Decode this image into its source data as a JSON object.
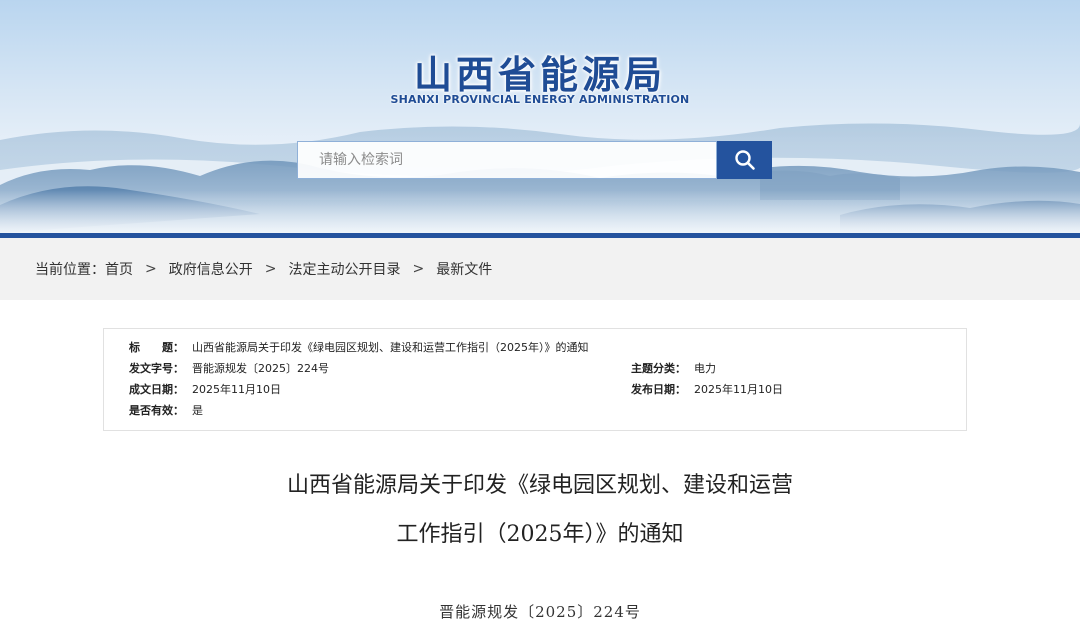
{
  "header": {
    "title_cn": "山西省能源局",
    "title_en": "SHANXI PROVINCIAL ENERGY ADMINISTRATION",
    "search_placeholder": "请输入检索词",
    "search_icon": "search-icon"
  },
  "breadcrumb": {
    "prefix": "当前位置：",
    "items": [
      "首页",
      "政府信息公开",
      "法定主动公开目录",
      "最新文件"
    ],
    "separator": ">"
  },
  "info": {
    "title_label": "标　　题：",
    "title_value": "山西省能源局关于印发《绿电园区规划、建设和运营工作指引（2025年）》的通知",
    "doc_no_label": "发文字号：",
    "doc_no_value": "晋能源规发〔2025〕224号",
    "category_label": "主题分类：",
    "category_value": "电力",
    "created_label": "成文日期：",
    "created_value": "2025年11月10日",
    "published_label": "发布日期：",
    "published_value": "2025年11月10日",
    "valid_label": "是否有效：",
    "valid_value": "是"
  },
  "article": {
    "title_line1": "山西省能源局关于印发《绿电园区规划、建设和运营",
    "title_line2": "工作指引（2025年）》的通知",
    "doc_number": "晋能源规发〔2025〕224号"
  },
  "colors": {
    "brand": "#1f4c95",
    "accent_bar": "#24539e",
    "crumb_bg": "#f2f2f2"
  }
}
